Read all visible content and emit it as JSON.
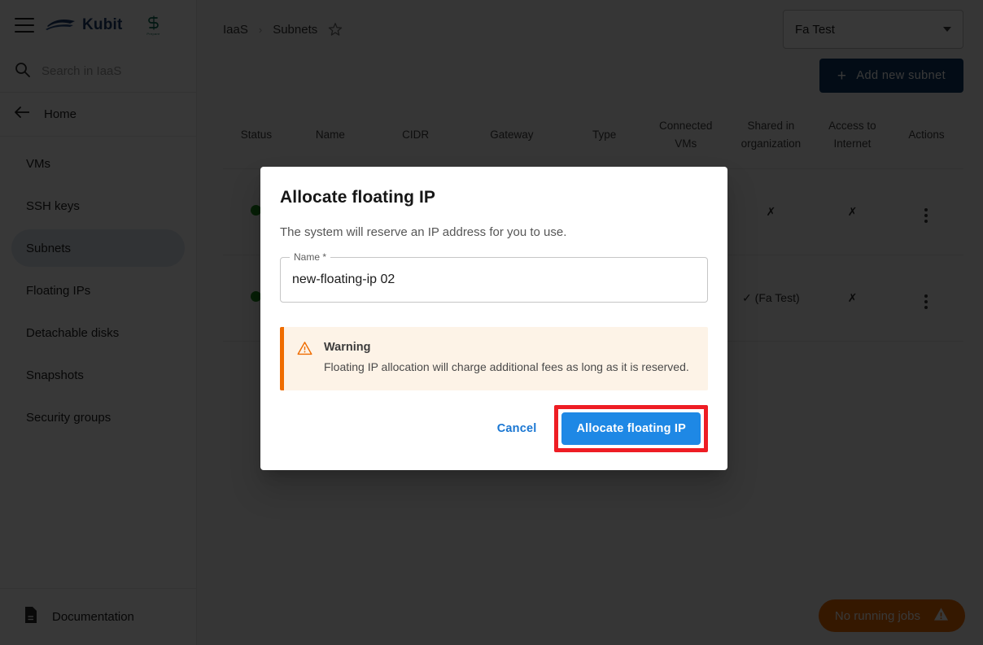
{
  "header": {
    "menu_icon": "hamburger-icon",
    "brand": "Kubit",
    "brand_mark_icon": "wave-boat-logo-icon",
    "partner_mark_icon": "partner-s-logo-icon",
    "partner_sub": "Prepare"
  },
  "search": {
    "icon": "search-icon",
    "placeholder": "Search in IaaS",
    "value": ""
  },
  "sidebar": {
    "back_icon": "arrow-left-icon",
    "home_label": "Home",
    "items": [
      {
        "label": "VMs",
        "active": false
      },
      {
        "label": "SSH keys",
        "active": false
      },
      {
        "label": "Subnets",
        "active": true
      },
      {
        "label": "Floating IPs",
        "active": false
      },
      {
        "label": "Detachable disks",
        "active": false
      },
      {
        "label": "Snapshots",
        "active": false
      },
      {
        "label": "Security groups",
        "active": false
      }
    ],
    "footer": {
      "icon": "document-icon",
      "label": "Documentation"
    }
  },
  "topbar": {
    "breadcrumb": [
      "IaaS",
      "Subnets"
    ],
    "separator": "›",
    "favorite_icon": "star-outline-icon",
    "project_select": {
      "value": "Fa Test",
      "icon": "chevron-down-icon"
    },
    "add_button": {
      "label": "Add new subnet",
      "icon": "plus-icon"
    }
  },
  "table": {
    "columns": [
      "Status",
      "Name",
      "CIDR",
      "Gateway",
      "Type",
      "Connected VMs",
      "Shared in organization",
      "Access to Internet",
      "Actions"
    ],
    "rows": [
      {
        "status_icon": "status-dot-green",
        "name": "",
        "cidr": "",
        "gateway": "",
        "type": "",
        "connected_vms": "",
        "shared_in_organization": "✗",
        "access_to_internet": "✗",
        "actions_icon": "more-vertical-icon"
      },
      {
        "status_icon": "status-dot-green",
        "name": "",
        "cidr": "",
        "gateway": "",
        "type": "",
        "connected_vms": "",
        "shared_in_organization": "✓ (Fa Test)",
        "access_to_internet": "✗",
        "actions_icon": "more-vertical-icon"
      }
    ]
  },
  "jobs_pill": {
    "label": "No running jobs",
    "icon": "warning-triangle-icon"
  },
  "dialog": {
    "title": "Allocate floating IP",
    "subtitle": "The system will reserve an IP address for you to use.",
    "name_field": {
      "label": "Name *",
      "value": "new-floating-ip 02",
      "placeholder": ""
    },
    "warning": {
      "icon": "warning-triangle-icon",
      "title": "Warning",
      "text": "Floating IP allocation will charge additional fees as long as it is reserved."
    },
    "cancel_label": "Cancel",
    "confirm_label": "Allocate floating IP"
  },
  "colors": {
    "brand_blue": "#1d3c6e",
    "primary_button": "#0e3a64",
    "cta_blue": "#1e88e5",
    "link_blue": "#1976d2",
    "warning_orange": "#ef6c00",
    "warning_bg": "#fdf3e7",
    "status_green": "#1f8a1f",
    "highlight_red": "#ee1d24",
    "nav_active_bg": "#dfe6f2"
  }
}
